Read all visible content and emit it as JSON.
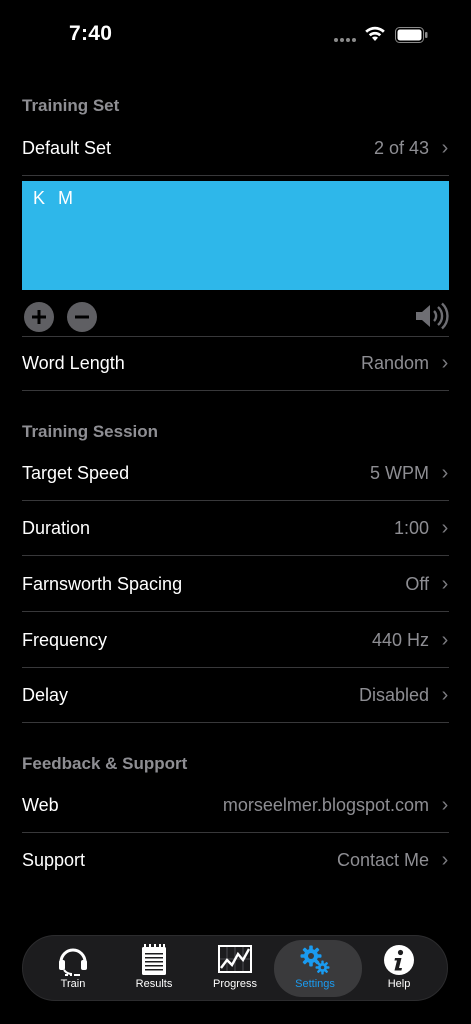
{
  "status": {
    "time": "7:40"
  },
  "training_set": {
    "header": "Training Set",
    "default_set_label": "Default Set",
    "default_set_value": "2 of 43",
    "characters": "K  M",
    "word_length_label": "Word Length",
    "word_length_value": "Random"
  },
  "training_session": {
    "header": "Training Session",
    "rows": [
      {
        "label": "Target Speed",
        "value": "5 WPM"
      },
      {
        "label": "Duration",
        "value": "1:00"
      },
      {
        "label": "Farnsworth Spacing",
        "value": "Off"
      },
      {
        "label": "Frequency",
        "value": "440 Hz"
      },
      {
        "label": "Delay",
        "value": "Disabled"
      }
    ]
  },
  "feedback": {
    "header": "Feedback & Support",
    "rows": [
      {
        "label": "Web",
        "value": "morseelmer.blogspot.com"
      },
      {
        "label": "Support",
        "value": "Contact Me"
      }
    ]
  },
  "tabs": [
    {
      "label": "Train",
      "icon": "headset-icon"
    },
    {
      "label": "Results",
      "icon": "notepad-icon"
    },
    {
      "label": "Progress",
      "icon": "chart-icon"
    },
    {
      "label": "Settings",
      "icon": "gear-icon",
      "active": true
    },
    {
      "label": "Help",
      "icon": "info-icon"
    }
  ],
  "colors": {
    "accent": "#1a9bf0",
    "charbox": "#2eb7ea",
    "secondary_text": "#8e8e93"
  }
}
